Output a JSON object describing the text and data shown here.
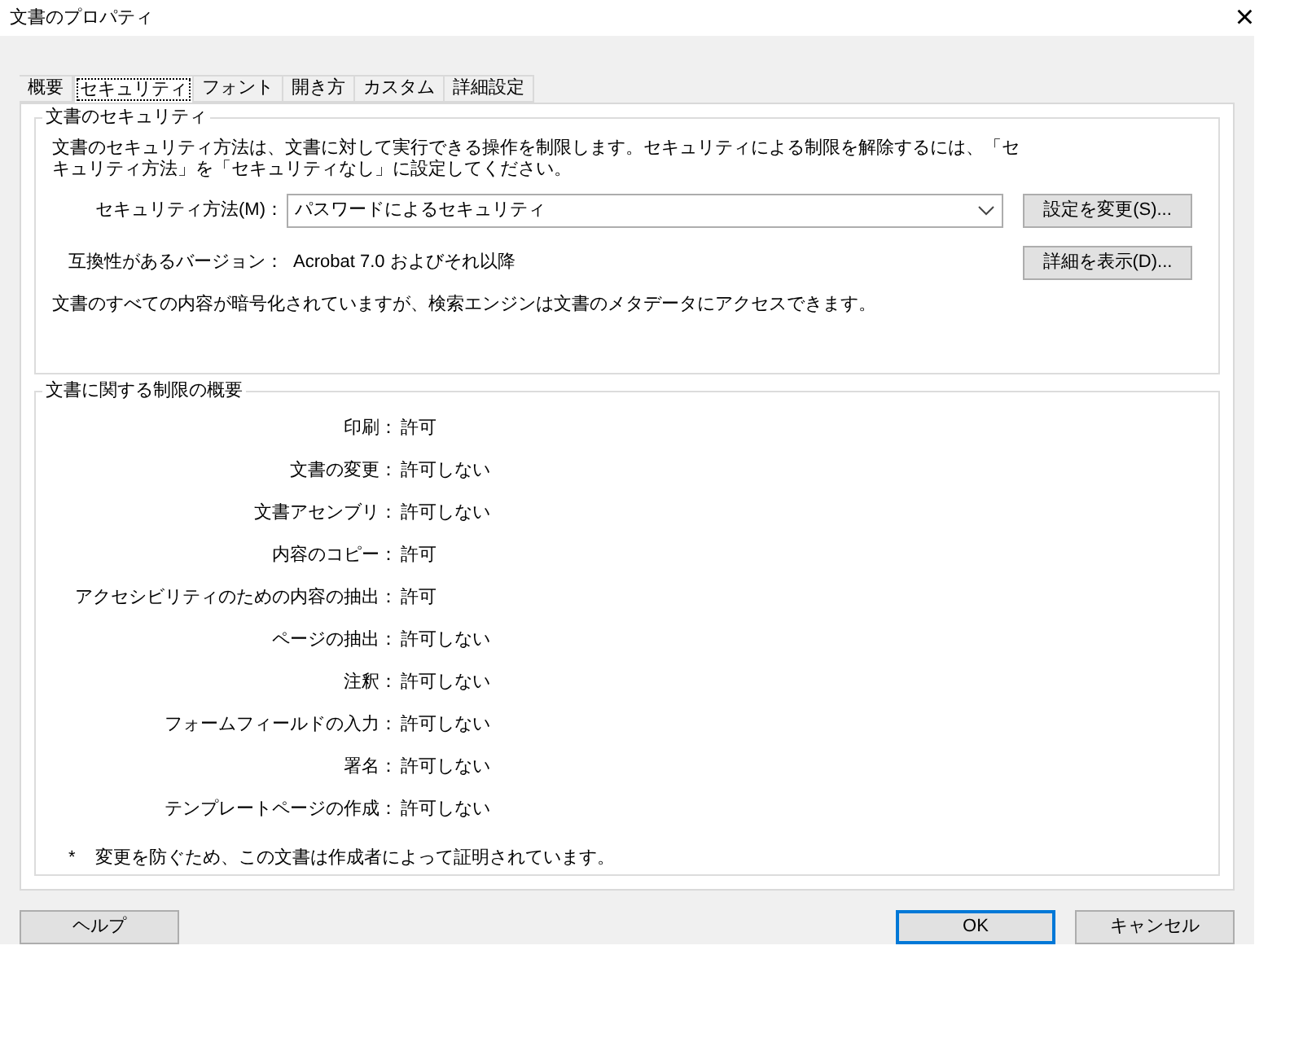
{
  "window": {
    "title": "文書のプロパティ",
    "close": "×"
  },
  "tabs": [
    {
      "label": "概要",
      "selected": false
    },
    {
      "label": "セキュリティ",
      "selected": true
    },
    {
      "label": "フォント",
      "selected": false
    },
    {
      "label": "開き方",
      "selected": false
    },
    {
      "label": "カスタム",
      "selected": false
    },
    {
      "label": "詳細設定",
      "selected": false
    }
  ],
  "security": {
    "title": "文書のセキュリティ",
    "description": "文書のセキュリティ方法は、文書に対して実行できる操作を制限します。セキュリティによる制限を解除するには、「セキュリティ方法」を「セキュリティなし」に設定してください。",
    "method_label": "セキュリティ方法(M)：",
    "method_value": "パスワードによるセキュリティ",
    "change_button": "設定を変更(S)...",
    "version_label": "互換性があるバージョン：",
    "version_value": "Acrobat 7.0 およびそれ以降",
    "details_button": "詳細を表示(D)...",
    "note": "文書のすべての内容が暗号化されていますが、検索エンジンは文書のメタデータにアクセスできます。"
  },
  "restrictions": {
    "title": "文書に関する制限の概要",
    "rows": [
      {
        "label": "印刷：",
        "value": "許可"
      },
      {
        "label": "文書の変更：",
        "value": "許可しない"
      },
      {
        "label": "文書アセンブリ：",
        "value": "許可しない"
      },
      {
        "label": "内容のコピー：",
        "value": "許可"
      },
      {
        "label": "アクセシビリティのための内容の抽出：",
        "value": "許可"
      },
      {
        "label": "ページの抽出：",
        "value": "許可しない"
      },
      {
        "label": "注釈：",
        "value": "許可しない"
      },
      {
        "label": "フォームフィールドの入力：",
        "value": "許可しない"
      },
      {
        "label": "署名：",
        "value": "許可しない"
      },
      {
        "label": "テンプレートページの作成：",
        "value": "許可しない"
      }
    ],
    "footnote_mark": "*",
    "footnote": "変更を防ぐため、この文書は作成者によって証明されています。"
  },
  "buttons": [
    {
      "label": "ヘルプ",
      "kind": "help"
    },
    {
      "label": "OK",
      "kind": "default"
    },
    {
      "label": "キャンセル",
      "kind": "normal"
    }
  ]
}
